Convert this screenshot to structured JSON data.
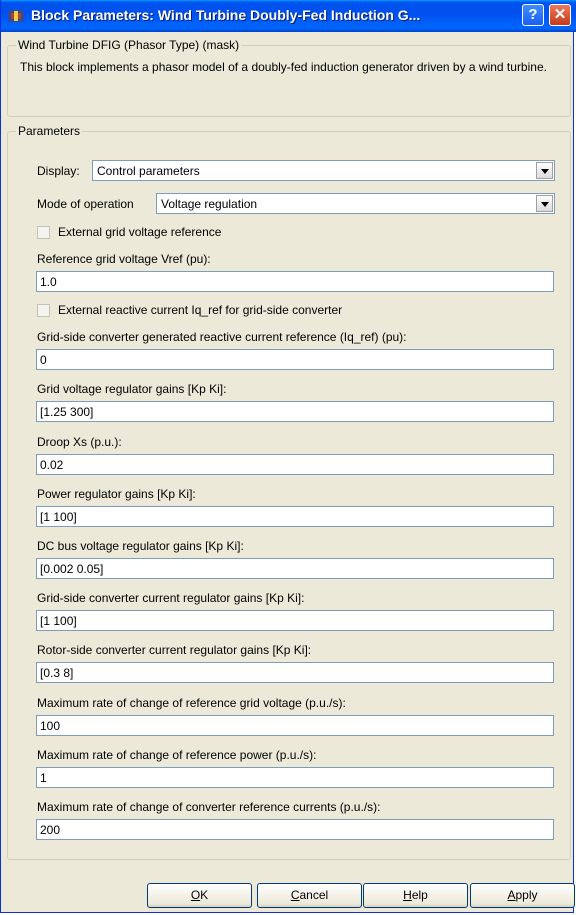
{
  "window": {
    "title": "Block Parameters: Wind Turbine Doubly-Fed Induction G...",
    "help_button": "?",
    "close_button": "✕"
  },
  "mask": {
    "legend": "Wind Turbine DFIG (Phasor Type) (mask)",
    "description": "This block implements a phasor model of a doubly-fed induction generator driven by a wind turbine."
  },
  "parameters": {
    "legend": "Parameters",
    "display": {
      "label": "Display:",
      "value": "Control parameters"
    },
    "mode": {
      "label": "Mode of operation",
      "value": "Voltage regulation"
    },
    "ext_voltage_ref": {
      "label": "External grid voltage reference",
      "checked": false
    },
    "vref": {
      "label": "Reference grid voltage Vref (pu):",
      "value": "1.0"
    },
    "ext_iq_ref": {
      "label": "External reactive current Iq_ref for grid-side converter",
      "checked": false
    },
    "iq_ref": {
      "label": "Grid-side converter generated reactive current reference (Iq_ref) (pu):",
      "value": "0"
    },
    "grid_voltage_gains": {
      "label": "Grid voltage regulator gains [Kp Ki]:",
      "value": "[1.25 300]"
    },
    "droop": {
      "label": "Droop Xs (p.u.):",
      "value": "0.02"
    },
    "power_gains": {
      "label": "Power regulator gains [Kp Ki]:",
      "value": "[1 100]"
    },
    "dc_bus_gains": {
      "label": "DC bus voltage regulator gains [Kp Ki]:",
      "value": "[0.002 0.05]"
    },
    "grid_side_current_gains": {
      "label": "Grid-side converter current regulator gains [Kp Ki]:",
      "value": "[1 100]"
    },
    "rotor_side_current_gains": {
      "label": "Rotor-side converter current regulator gains [Kp Ki]:",
      "value": "[0.3 8]"
    },
    "max_rate_voltage": {
      "label": "Maximum rate of change of reference grid voltage (p.u./s):",
      "value": "100"
    },
    "max_rate_power": {
      "label": "Maximum rate of change of reference power (p.u./s):",
      "value": "1"
    },
    "max_rate_currents": {
      "label": "Maximum rate of change of converter  reference currents (p.u./s):",
      "value": "200"
    }
  },
  "buttons": {
    "ok": {
      "mnemonic": "O",
      "rest": "K"
    },
    "cancel": {
      "mnemonic": "C",
      "rest": "ancel"
    },
    "help": {
      "mnemonic": "H",
      "rest": "elp"
    },
    "apply": {
      "mnemonic": "A",
      "rest": "pply"
    }
  }
}
